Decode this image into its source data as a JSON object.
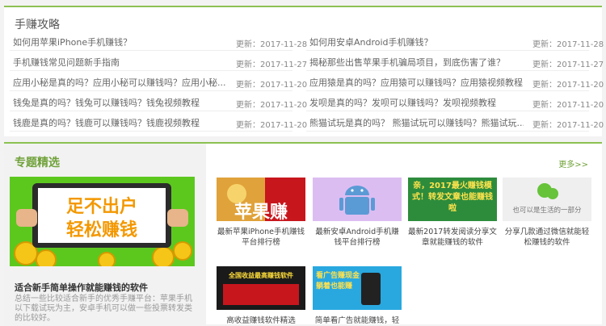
{
  "guide": {
    "title": "手赚攻略",
    "rows": [
      {
        "left": "如何用苹果iPhone手机赚钱？",
        "left_date": "更新：2017-11-28",
        "right": "如何用安卓Android手机赚钱？",
        "right_date": "更新：2017-11-28"
      },
      {
        "left": "手机赚钱常见问题新手指南",
        "left_date": "更新：2017-11-27",
        "right": "揭秘那些出售苹果手机骗局项目，到底伤害了谁？",
        "right_date": "更新：2017-11-27"
      },
      {
        "left": "应用小秘是真的吗？应用小秘可以赚钱吗？应用小秘...",
        "left_date": "更新：2017-11-20",
        "right": "应用猿是真的吗？应用猿可以赚钱吗？应用猿视频教程",
        "right_date": "更新：2017-11-20"
      },
      {
        "left": "钱兔是真的吗？钱兔可以赚钱吗？钱兔视频教程",
        "left_date": "更新：2017-11-20",
        "right": "发呗是真的吗？发呗可以赚钱吗？发呗视频教程",
        "right_date": "更新：2017-11-20"
      },
      {
        "left": "钱鹿是真的吗？钱鹿可以赚钱吗？钱鹿视频教程",
        "left_date": "更新：2017-11-20",
        "right": "熊猫试玩是真的吗？ 熊猫试玩可以赚钱吗？熊猫试玩...",
        "right_date": "更新：2017-11-20"
      }
    ]
  },
  "topics": {
    "title": "专题精选",
    "more": "更多>>",
    "feature": {
      "img_line1": "足不出户",
      "img_line2": "轻松赚钱",
      "title": "适合新手简单操作就能赚钱的软件",
      "desc": "总结一些比较适合新手的优秀手赚平台：苹果手机以下载试玩为主，安卓手机可以做一些投票转发类的比较好。"
    },
    "cards": [
      {
        "caption": "最新苹果iPhone手机赚钱平台排行榜",
        "img_text": "苹果赚",
        "accent": "#c8161d"
      },
      {
        "caption": "最新安卓Android手机赚钱平台排行榜",
        "img_text": "",
        "accent": "#5b9bd5"
      },
      {
        "caption": "最新2017转发阅读分享文章就能赚钱的软件",
        "img_text": "亲，2017最火赚钱模式！转发文章也能赚钱啦",
        "accent": "#2d8c3c"
      },
      {
        "caption": "分享几款通过微信就能轻松赚钱的软件",
        "img_text": "也可以是生活的一部分",
        "accent": "#aaaaaa"
      },
      {
        "caption": "高收益赚钱软件精选",
        "img_text": "全国收益最高赚钱软件",
        "accent": "#c8161d"
      },
      {
        "caption": "简单看广告就能赚钱，轻",
        "img_text": "看广告赚现金 躺着也能赚",
        "accent": "#f0a020"
      }
    ]
  }
}
